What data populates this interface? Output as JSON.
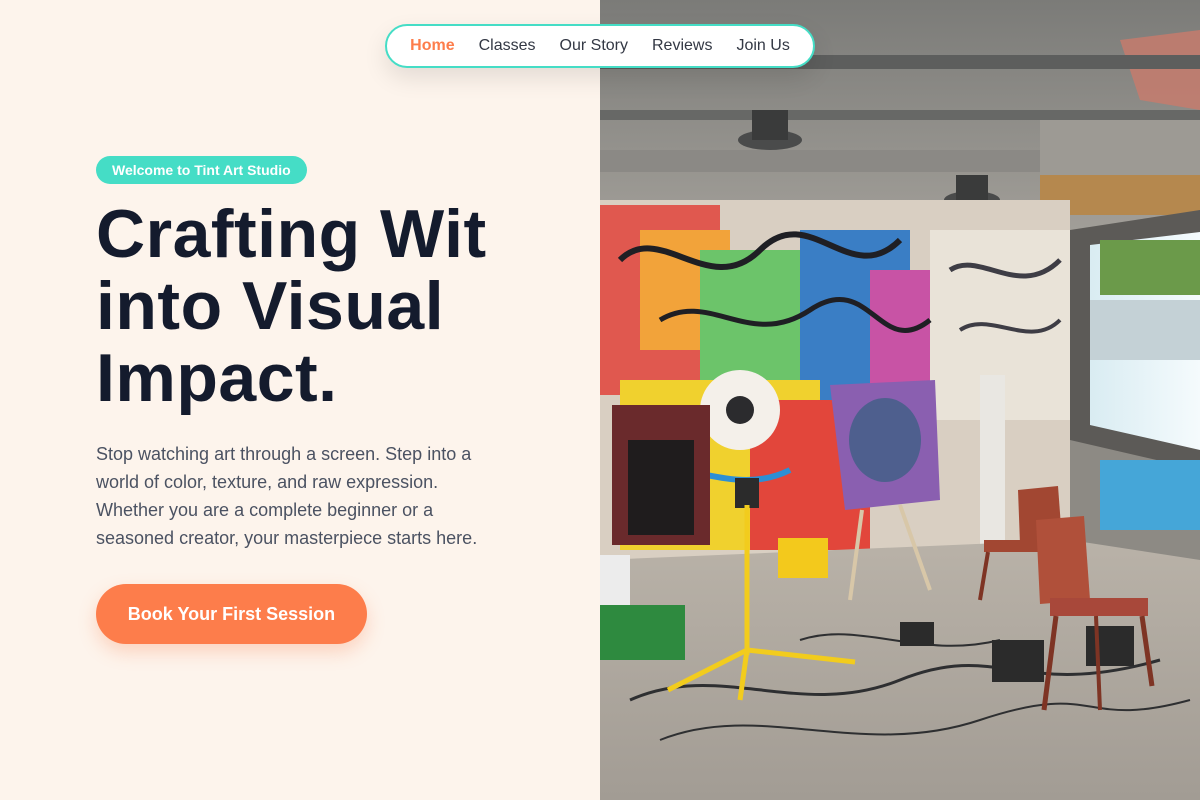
{
  "nav": {
    "items": [
      {
        "label": "Home",
        "active": true
      },
      {
        "label": "Classes"
      },
      {
        "label": "Our Story"
      },
      {
        "label": "Reviews"
      },
      {
        "label": "Join Us"
      }
    ]
  },
  "hero": {
    "badge": "Welcome to Tint Art Studio",
    "headline": [
      "Crafting Wit",
      "into Visual",
      "Impact."
    ],
    "description": "Stop watching art through a screen. Step into a world of color, texture, and raw expression. Whether you are a complete beginner or a seasoned creator, your masterpiece starts here.",
    "cta_label": "Book Your First Session"
  },
  "image": {
    "subject": "graffiti-art-studio-photo"
  },
  "colors": {
    "background": "#fdf4ec",
    "accent_teal": "#45ddc6",
    "accent_orange": "#fd7d4b",
    "heading": "#141b2d",
    "body_text": "#4b5262"
  }
}
